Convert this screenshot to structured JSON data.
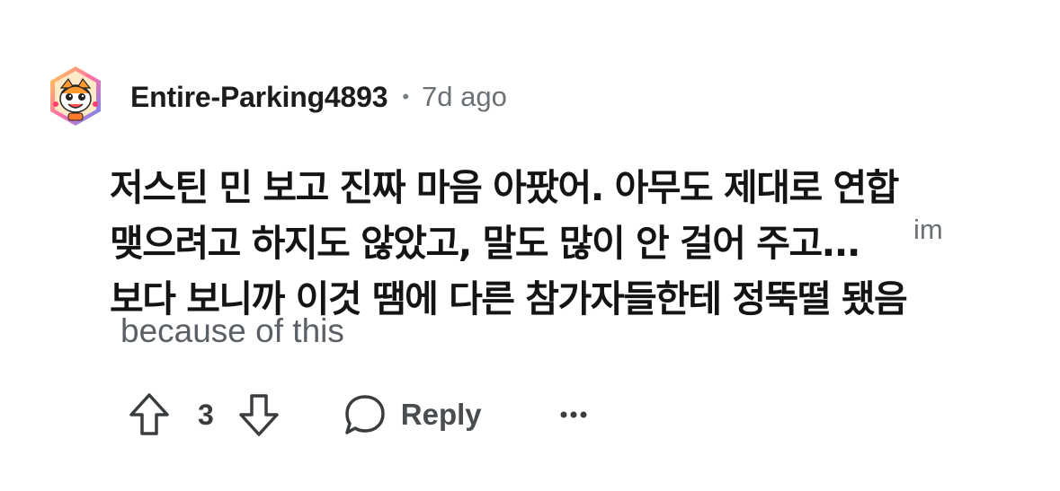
{
  "comment": {
    "author": "Entire-Parking4893",
    "separator": "•",
    "age": "7d ago",
    "avatar_icon": "tiger-snoo-avatar-icon",
    "body_lines": [
      "저스틴 민 보고 진짜 마음 아팠어. 아무도 제대로 연합",
      "맺으려고 하지도 않았고, 말도 많이 안 걸어 주고...",
      "보다 보니까 이것 땜에 다른 참가자들한테 정뚝떨 됐음"
    ],
    "overlay_fragments": [
      "im",
      "because of this"
    ]
  },
  "actions": {
    "upvote_icon": "arrow-up-icon",
    "vote_count": "3",
    "downvote_icon": "arrow-down-icon",
    "reply_icon": "speech-bubble-icon",
    "reply_label": "Reply",
    "more_icon": "ellipsis-icon"
  },
  "colors": {
    "text_primary": "#1c1c1c",
    "text_secondary": "#6b7075",
    "avatar_accent": "#ff7a2f"
  }
}
